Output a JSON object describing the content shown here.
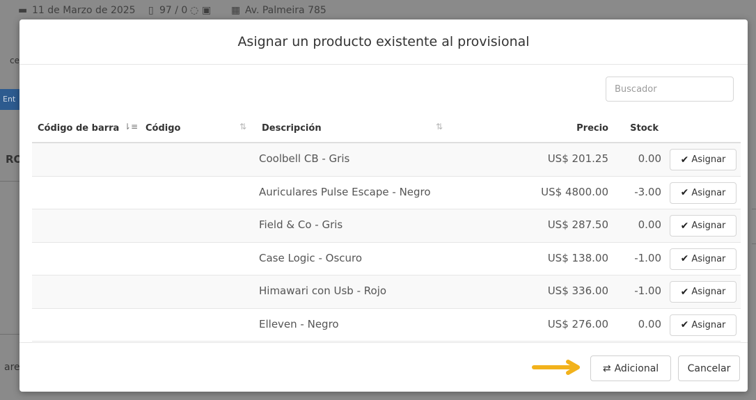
{
  "background": {
    "date": "11 de Marzo de 2025",
    "counter": "97 / 0",
    "address": "Av. Palmeira 785",
    "frag_tab": "ce",
    "frag_button": "Ent",
    "frag_section": "RO",
    "frag_bottom": "are"
  },
  "modal": {
    "title": "Asignar un producto existente al provisional",
    "search_placeholder": "Buscador",
    "columns": {
      "barcode": "Código de barra",
      "code": "Código",
      "description": "Descripción",
      "price": "Precio",
      "stock": "Stock"
    },
    "rows": [
      {
        "barcode": "",
        "code": "",
        "description": "Coolbell CB - Gris",
        "price": "US$ 201.25",
        "stock": "0.00",
        "action": "Asignar"
      },
      {
        "barcode": "",
        "code": "",
        "description": "Auriculares Pulse Escape - Negro",
        "price": "US$ 4800.00",
        "stock": "-3.00",
        "action": "Asignar"
      },
      {
        "barcode": "",
        "code": "",
        "description": "Field & Co - Gris",
        "price": "US$ 287.50",
        "stock": "0.00",
        "action": "Asignar"
      },
      {
        "barcode": "",
        "code": "",
        "description": "Case Logic - Oscuro",
        "price": "US$ 138.00",
        "stock": "-1.00",
        "action": "Asignar"
      },
      {
        "barcode": "",
        "code": "",
        "description": "Himawari con Usb - Rojo",
        "price": "US$ 336.00",
        "stock": "-1.00",
        "action": "Asignar"
      },
      {
        "barcode": "",
        "code": "",
        "description": "Elleven - Negro",
        "price": "US$ 276.00",
        "stock": "0.00",
        "action": "Asignar"
      }
    ],
    "footer": {
      "adicional_label": "Adicional",
      "cancelar_label": "Cancelar"
    }
  },
  "icons": {
    "check": "check-icon",
    "repeat": "repeat-icon",
    "sort": "sort-icon",
    "arrow": "pointer-arrow-icon"
  },
  "colors": {
    "arrow": "#f2b21c",
    "overlay": "#8a8a8a",
    "bg_button": "#2d5b8f"
  }
}
